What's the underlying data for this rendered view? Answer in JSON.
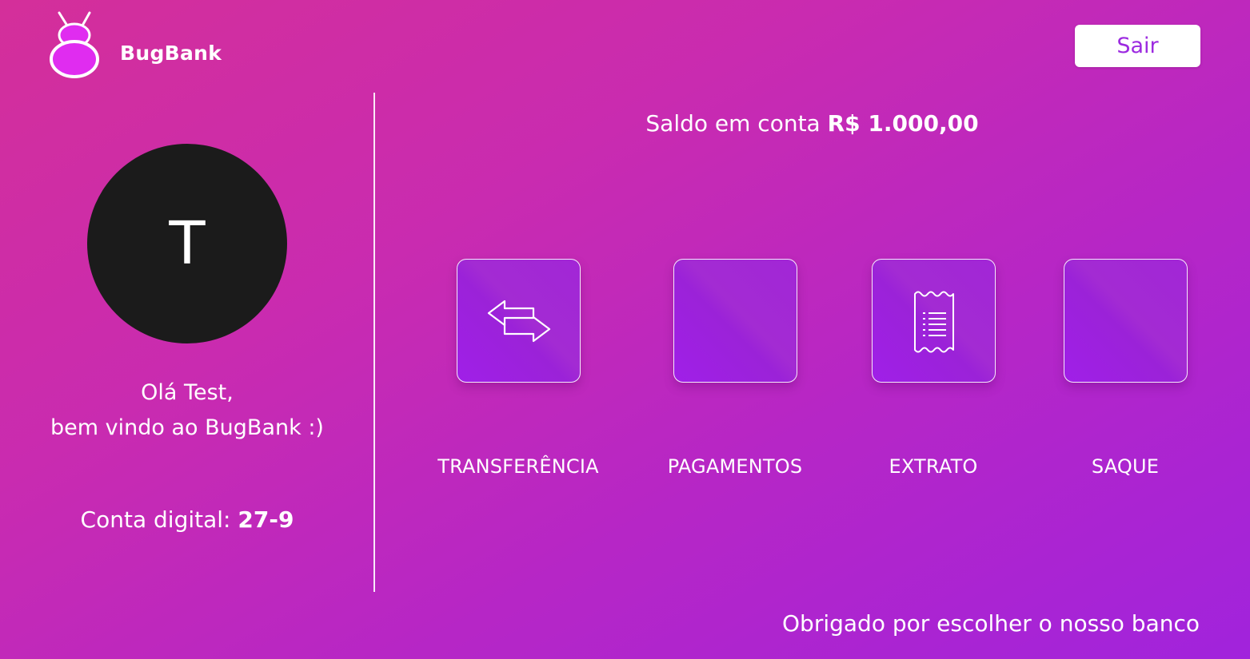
{
  "header": {
    "brand_name": "BugBank",
    "logo_icon": "bug-logo-icon",
    "exit_label": "Sair"
  },
  "user": {
    "avatar_letter": "T",
    "greeting_line1": "Olá Test,",
    "greeting_line2": "bem vindo ao BugBank :)",
    "account_label": "Conta digital:",
    "account_number": "27-9"
  },
  "balance": {
    "label": "Saldo em conta",
    "value": "R$ 1.000,00"
  },
  "actions": [
    {
      "label": "TRANSFERÊNCIA",
      "icon": "transfer-arrows-icon"
    },
    {
      "label": "PAGAMENTOS",
      "icon": ""
    },
    {
      "label": "EXTRATO",
      "icon": "receipt-icon"
    },
    {
      "label": "SAQUE",
      "icon": ""
    }
  ],
  "footer": {
    "text": "Obrigado por escolher o nosso banco"
  },
  "colors": {
    "background_start": "#d42f9a",
    "background_end": "#a123dc",
    "accent": "#9c2ae0",
    "avatar_bg": "#1b1b1b"
  }
}
